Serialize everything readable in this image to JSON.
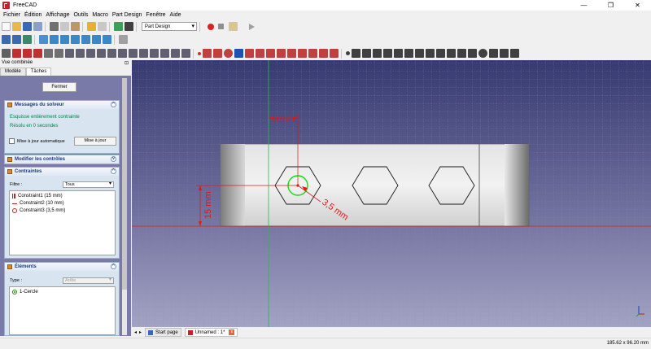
{
  "window": {
    "title": "FreeCAD",
    "minimize": "—",
    "maximize": "❐",
    "close": "✕"
  },
  "menu": [
    "Fichier",
    "Édition",
    "Affichage",
    "Outils",
    "Macro",
    "Part Design",
    "Fenêtre",
    "Aide"
  ],
  "toolbar": {
    "workbench": "Part Design"
  },
  "combo_view": {
    "title": "Vue combinée",
    "pin": "⊡",
    "tabs": [
      "Modèle",
      "Tâches"
    ]
  },
  "task": {
    "close_label": "Fermer",
    "solver": {
      "title": "Messages du solveur",
      "status": "Esquisse entièrement contrainte",
      "time": "Résolu en 0 secondes",
      "auto_update": "Mise à jour automatique",
      "update_button": "Mise à jour"
    },
    "edit_controls": {
      "title": "Modifier les contrôles"
    },
    "constraints": {
      "title": "Contraintes",
      "filter_label": "Filtre :",
      "filter_value": "Tous",
      "items": [
        "Constraint1 (15 mm)",
        "Constraint2 (10 mm)",
        "Constraint3 (3,5 mm)"
      ]
    },
    "elements": {
      "title": "Éléments",
      "type_label": "Type :",
      "type_value": "Arête",
      "items": [
        "1-Cercle"
      ]
    }
  },
  "sketch": {
    "dim_15": "15 mm",
    "dim_10": "10 mm",
    "dim_35": "3,5 mm"
  },
  "doc_tabs": [
    {
      "label": "Start page",
      "active": false
    },
    {
      "label": "Unnamed : 1*",
      "active": true
    }
  ],
  "status": {
    "dimensions": "185.62 x 96.20 mm"
  },
  "colors": {
    "constraint": "#e01818",
    "selected": "#10e010",
    "bg_top": "#363a70",
    "bg_bottom": "#a3a3c4"
  }
}
